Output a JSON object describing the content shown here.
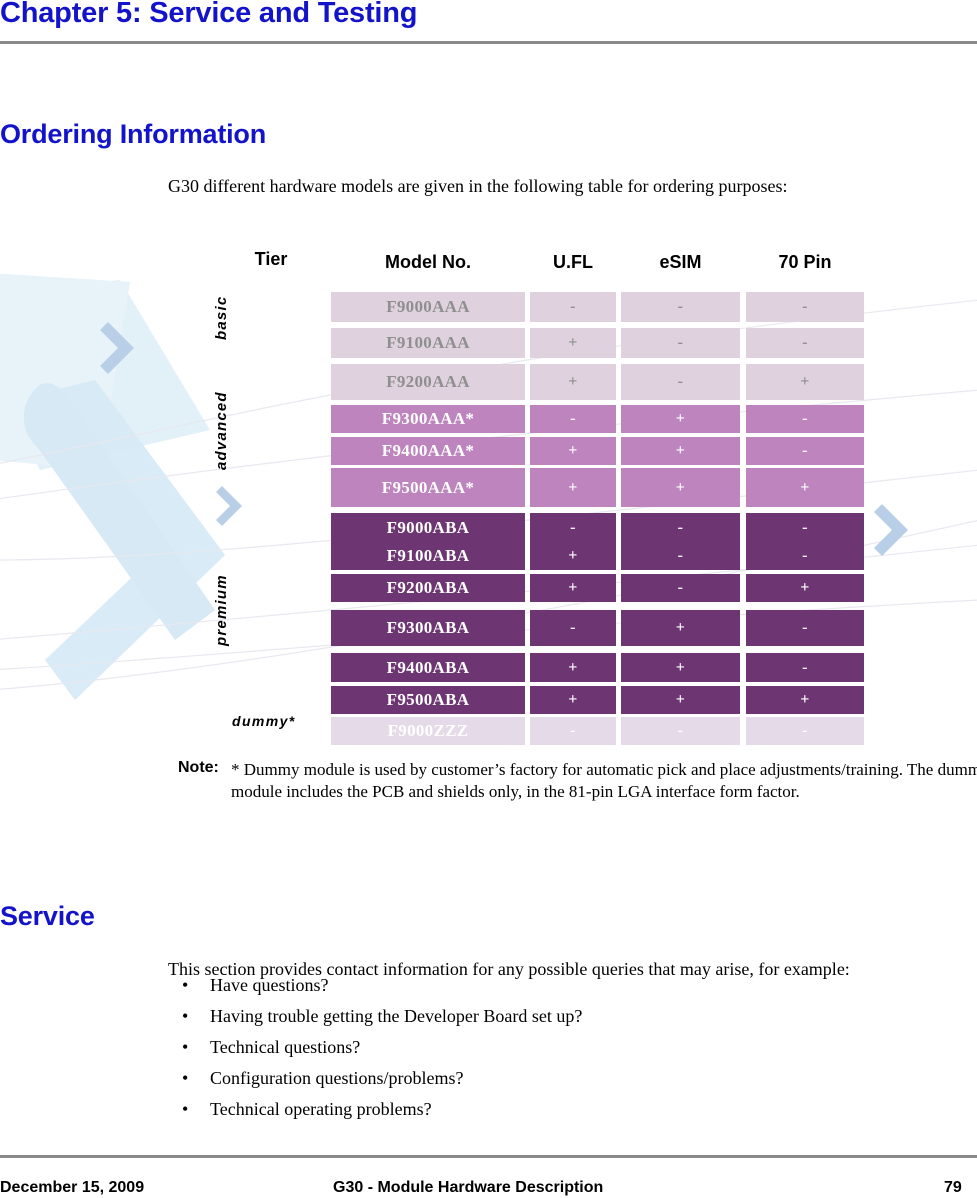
{
  "chapter": {
    "title": "Chapter 5: Service and Testing"
  },
  "sections": {
    "ordering": {
      "heading": "Ordering Information",
      "intro": "G30 different hardware models are given in the following table for ordering purposes:"
    },
    "service": {
      "heading": "Service",
      "intro": "This section provides contact information for any possible queries that may arise, for example:",
      "bullets": [
        "Have questions?",
        "Having trouble getting the Developer Board set up?",
        "Technical questions?",
        "Configuration questions/problems?",
        "Technical operating problems?"
      ],
      "bullet_glyph": "•"
    }
  },
  "table": {
    "tier_header": "Tier",
    "columns": [
      "Model No.",
      "U.FL",
      "eSIM",
      "70 Pin"
    ],
    "tier_labels": {
      "basic": "basic",
      "advanced": "advanced",
      "premium": "premium",
      "dummy": "dummy*"
    },
    "colors": {
      "basic": "#dfd1dd",
      "advanced": "#bd84bd",
      "premium": "#6d3571",
      "dummy": "#e5dae7",
      "basic_text": "#8f8f8f",
      "light_text": "#ffffff",
      "heading_blue": "#1313c9",
      "rule_gray": "#8a8a8a"
    },
    "rows": [
      {
        "model": "F9000AAA",
        "ufl": "-",
        "esim": "-",
        "pin": "-",
        "tier": "basic"
      },
      {
        "model": "F9100AAA",
        "ufl": "+",
        "esim": "-",
        "pin": "-",
        "tier": "basic"
      },
      {
        "model": "F9200AAA",
        "ufl": "+",
        "esim": "-",
        "pin": "+",
        "tier": "basic"
      },
      {
        "model": "F9300AAA*",
        "ufl": "-",
        "esim": "+",
        "pin": "-",
        "tier": "advanced"
      },
      {
        "model": "F9400AAA*",
        "ufl": "+",
        "esim": "+",
        "pin": "-",
        "tier": "advanced"
      },
      {
        "model": "F9500AAA*",
        "ufl": "+",
        "esim": "+",
        "pin": "+",
        "tier": "advanced"
      },
      {
        "model": "F9000ABA",
        "ufl": "-",
        "esim": "-",
        "pin": "-",
        "tier": "premium"
      },
      {
        "model": "F9100ABA",
        "ufl": "+",
        "esim": "-",
        "pin": "-",
        "tier": "premium"
      },
      {
        "model": "F9200ABA",
        "ufl": "+",
        "esim": "-",
        "pin": "+",
        "tier": "premium"
      },
      {
        "model": "F9300ABA",
        "ufl": "-",
        "esim": "+",
        "pin": "-",
        "tier": "premium"
      },
      {
        "model": "F9400ABA",
        "ufl": "+",
        "esim": "+",
        "pin": "-",
        "tier": "premium"
      },
      {
        "model": "F9500ABA",
        "ufl": "+",
        "esim": "+",
        "pin": "+",
        "tier": "premium"
      },
      {
        "model": "F9000ZZZ",
        "ufl": "-",
        "esim": "-",
        "pin": "-",
        "tier": "dummy"
      }
    ]
  },
  "note": {
    "label": "Note:",
    "text": "* Dummy module is used by customer’s factory for automatic pick and place adjustments/training. The dummy module includes the PCB and shields only, in the 81-pin LGA interface form factor."
  },
  "footer": {
    "date": "December 15, 2009",
    "document": "G30 - Module Hardware Description",
    "page": "79"
  }
}
